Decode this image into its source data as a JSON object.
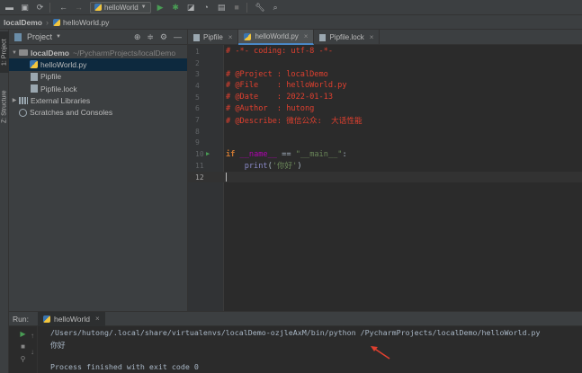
{
  "toolbar": {
    "run_config": "helloWorld"
  },
  "breadcrumb": [
    "localDemo",
    "helloWorld.py"
  ],
  "stripe": {
    "project_tab": "1: Project",
    "structure_tab": "Z: Structure"
  },
  "project": {
    "title": "Project",
    "tree": [
      {
        "label": "localDemo",
        "hint": "~/PycharmProjects/localDemo"
      },
      {
        "label": "helloWorld.py"
      },
      {
        "label": "Pipfile"
      },
      {
        "label": "Pipfile.lock"
      },
      {
        "label": "External Libraries"
      },
      {
        "label": "Scratches and Consoles"
      }
    ]
  },
  "tabs": [
    {
      "label": "Pipfile"
    },
    {
      "label": "helloWorld.py"
    },
    {
      "label": "Pipfile.lock"
    }
  ],
  "editor": {
    "line_numbers": [
      "1",
      "2",
      "3",
      "4",
      "5",
      "6",
      "7",
      "8",
      "9",
      "10",
      "11",
      "12"
    ],
    "lines": {
      "l1": "# -*- coding: utf-8 -*-",
      "l3": "# @Project : localDemo",
      "l4": "# @File    : helloWorld.py",
      "l5": "# @Date    : 2022-01-13",
      "l6": "# @Author  : hutong",
      "l7": "# @Describe: 微信公众:  大话性能",
      "l10_kw": "if",
      "l10_name": "__name__",
      "l10_eq": "==",
      "l10_str": "\"__main__\"",
      "l10_colon": ":",
      "l11_fn": "print",
      "l11_open": "(",
      "l11_str": "'你好'",
      "l11_close": ")"
    }
  },
  "run": {
    "label": "Run:",
    "tab": "helloWorld",
    "console": [
      "/Users/hutong/.local/share/virtualenvs/localDemo-ozjleAxM/bin/python /PycharmProjects/localDemo/helloWorld.py",
      "你好",
      "",
      "Process finished with exit code 0"
    ]
  },
  "colors": {
    "comment_red": "#e0402f",
    "keyword": "#cc7832",
    "string": "#6a8759",
    "dunder": "#b200b2",
    "annotation_arrow": "#e0402f"
  }
}
